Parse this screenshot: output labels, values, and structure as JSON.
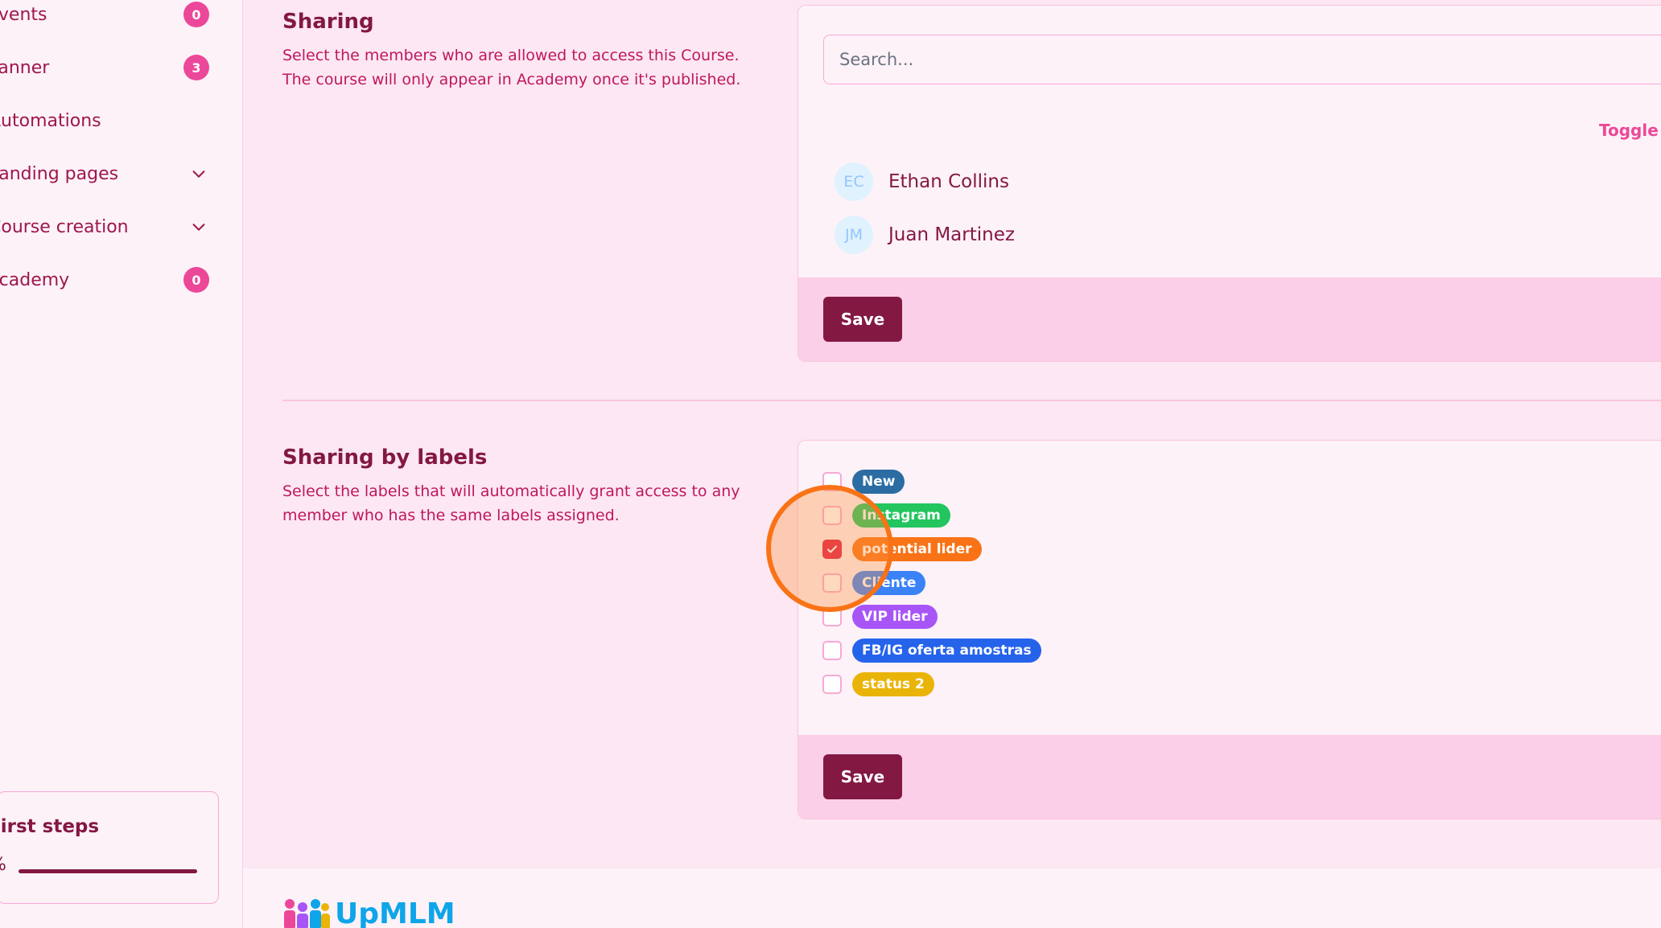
{
  "sidebar": {
    "items": [
      {
        "label": "Events",
        "badge": "0"
      },
      {
        "label": "Planner",
        "badge": "3"
      },
      {
        "label": "Automations"
      },
      {
        "label": "Landing pages"
      },
      {
        "label": "Course creation"
      },
      {
        "label": "Academy",
        "badge": "0"
      }
    ],
    "first_steps": {
      "title": "First steps",
      "percent_text": "%"
    }
  },
  "sharing": {
    "title": "Sharing",
    "desc_line1": "Select the members who are allowed to access this Course.",
    "desc_line2": "The course will only appear in Academy once it's published.",
    "search_placeholder": "Search...",
    "toggle_label": "Toggle",
    "members": [
      {
        "initials": "EC",
        "name": "Ethan Collins"
      },
      {
        "initials": "JM",
        "name": "Juan Martinez"
      }
    ],
    "save_label": "Save"
  },
  "labels_section": {
    "title": "Sharing by labels",
    "desc_line1": "Select the labels that will automatically grant access to any",
    "desc_line2": "member who has the same labels assigned.",
    "labels": [
      {
        "name": "New",
        "color": "#2b6ca3",
        "checked": false
      },
      {
        "name": "Instagram",
        "color": "#22c55e",
        "checked": false
      },
      {
        "name": "potential lider",
        "color": "#f97316",
        "checked": true
      },
      {
        "name": "Cliente",
        "color": "#3b82f6",
        "checked": false
      },
      {
        "name": "VIP lider",
        "color": "#a855f7",
        "checked": false
      },
      {
        "name": "FB/IG oferta amostras",
        "color": "#2563eb",
        "checked": false
      },
      {
        "name": "status 2",
        "color": "#eab308",
        "checked": false
      }
    ],
    "save_label": "Save"
  },
  "footer": {
    "logo_text": "UpMLM"
  },
  "colors": {
    "accent": "#831843",
    "badge": "#ec4899",
    "cursor": "#f97316"
  }
}
